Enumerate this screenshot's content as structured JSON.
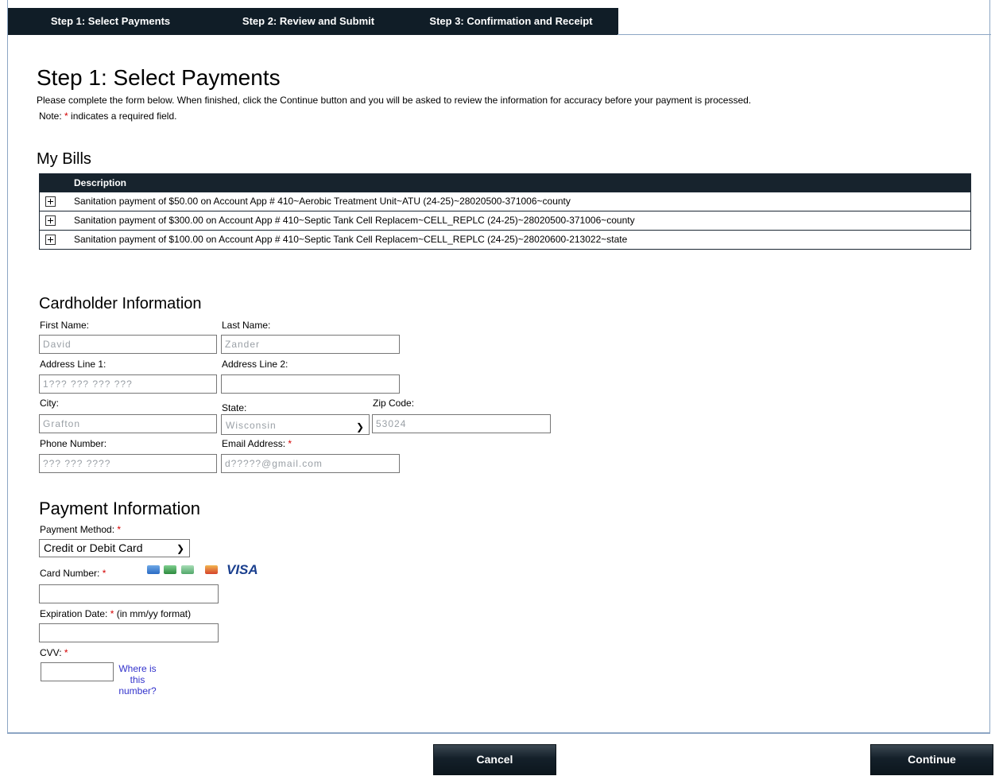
{
  "tabs": [
    {
      "label": "Step 1: Select Payments"
    },
    {
      "label": "Step 2: Review and Submit"
    },
    {
      "label": "Step 3: Confirmation and Receipt"
    }
  ],
  "page": {
    "title": "Step 1: Select Payments",
    "intro": "Please complete the form below. When finished, click the Continue button and you will be asked to review the information for accuracy before your payment is processed.",
    "note_prefix": "Note:",
    "note_star": "*",
    "note_suffix": "indicates a required field."
  },
  "bills": {
    "heading": "My Bills",
    "column": "Description",
    "rows": [
      {
        "description": "Sanitation payment of $50.00 on Account App # 410~Aerobic Treatment Unit~ATU (24-25)~28020500-371006~county"
      },
      {
        "description": "Sanitation payment of $300.00 on Account App # 410~Septic Tank Cell Replacem~CELL_REPLC (24-25)~28020500-371006~county"
      },
      {
        "description": "Sanitation payment of $100.00 on Account App # 410~Septic Tank Cell Replacem~CELL_REPLC (24-25)~28020600-213022~state"
      }
    ]
  },
  "cardholder": {
    "heading": "Cardholder Information",
    "first_name_label": "First Name:",
    "first_name_value": "David",
    "last_name_label": "Last Name:",
    "last_name_value": "Zander",
    "address1_label": "Address Line 1:",
    "address1_value": "1??? ??? ??? ???",
    "address2_label": "Address Line 2:",
    "address2_value": "",
    "city_label": "City:",
    "city_value": "Grafton",
    "state_label": "State:",
    "state_value": "Wisconsin",
    "zip_label": "Zip Code:",
    "zip_value": "53024",
    "phone_label": "Phone Number:",
    "phone_value": "??? ??? ????",
    "email_label": "Email Address:",
    "email_star": "*",
    "email_value": "d?????@gmail.com"
  },
  "payment": {
    "heading": "Payment Information",
    "method_label": "Payment Method:",
    "method_value": "Credit or Debit Card",
    "card_number_label": "Card Number:",
    "card_brand_text": "VISA",
    "expiration_label": "Expiration Date:",
    "expiration_hint": "(in mm/yy format)",
    "cvv_label": "CVV:",
    "cvv_help": "Where is this number?",
    "star": "*"
  },
  "buttons": {
    "cancel": "Cancel",
    "continue": "Continue"
  },
  "colors": {
    "header_bg": "#101d27",
    "required": "#d40000",
    "link": "#3333cc"
  }
}
